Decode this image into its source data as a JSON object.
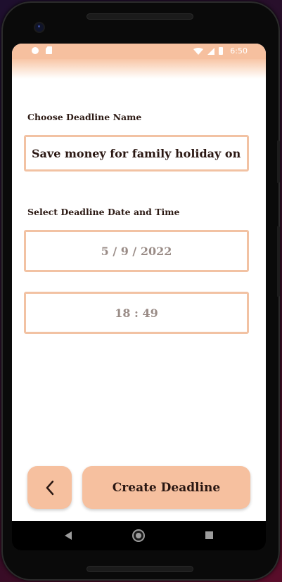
{
  "status_bar": {
    "time": "6:50"
  },
  "form": {
    "name_label": "Choose Deadline Name",
    "name_value": "Save money for family holiday on",
    "date_label": "Select Deadline Date and Time",
    "date_value": "5 / 9 / 2022",
    "time_value": "18 : 49"
  },
  "actions": {
    "create_label": "Create Deadline"
  },
  "colors": {
    "accent": "#f6c09f",
    "field_border": "#f2c2a3",
    "text_dark": "#2c1a14",
    "text_muted": "#9a8c87"
  },
  "icons": {
    "back": "chevron-left-icon",
    "nav_back": "nav-back-icon",
    "nav_home": "nav-home-icon",
    "nav_recent": "nav-recents-icon"
  }
}
